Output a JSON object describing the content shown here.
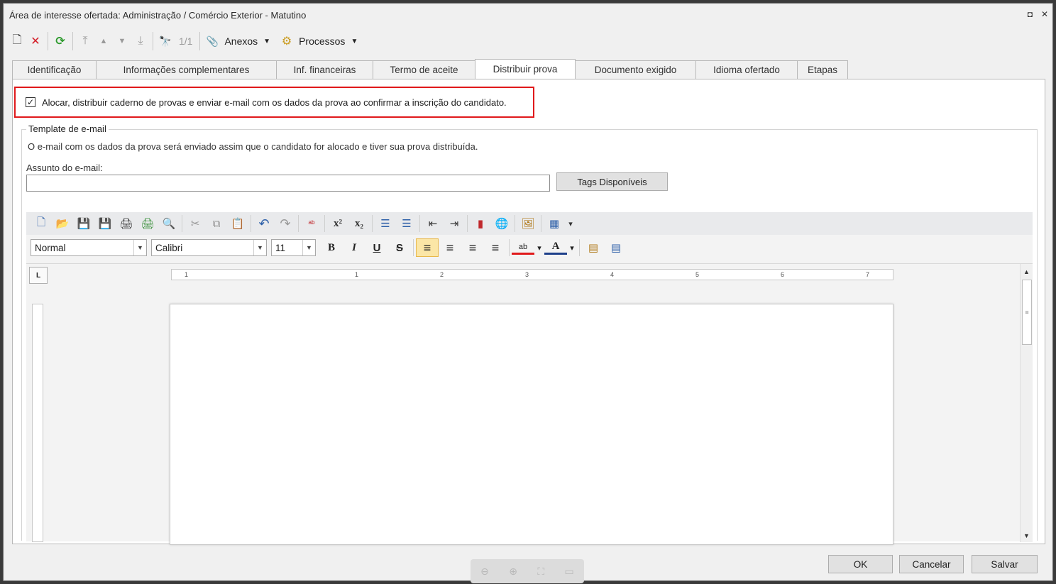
{
  "window": {
    "title": "Área de interesse ofertada: Administração / Comércio Exterior - Matutino",
    "restore_glyph": "◘",
    "close_glyph": "✕"
  },
  "toolbar": {
    "new_glyph": "🗋",
    "delete_glyph": "✕",
    "refresh_glyph": "⟳",
    "first_glyph": "⤒",
    "prev_glyph": "▲",
    "next_glyph": "▼",
    "last_glyph": "⤓",
    "find_glyph": "🔭",
    "record_counter": "1/1",
    "attach_glyph": "📎",
    "attachments_label": "Anexos",
    "process_glyph": "⚙",
    "processes_label": "Processos",
    "drop_glyph": "▼",
    "icons": [
      "new-icon",
      "delete-icon",
      "refresh-icon",
      "first-record-icon",
      "previous-record-icon",
      "next-record-icon",
      "last-record-icon",
      "binoculars-icon",
      "paperclip-icon",
      "gears-icon"
    ]
  },
  "tabs": [
    {
      "label": "Identificação",
      "active": false
    },
    {
      "label": "Informações complementares",
      "active": false
    },
    {
      "label": "Inf. financeiras",
      "active": false
    },
    {
      "label": "Termo de aceite",
      "active": false
    },
    {
      "label": "Distribuir prova",
      "active": true
    },
    {
      "label": "Documento exigido",
      "active": false
    },
    {
      "label": "Idioma ofertado",
      "active": false
    },
    {
      "label": "Etapas",
      "active": false
    }
  ],
  "panel": {
    "checkbox_checked": true,
    "checkbox_glyph": "✓",
    "checkbox_label": "Alocar, distribuir caderno de provas e enviar e-mail com os dados da prova ao confirmar a inscrição do candidato.",
    "highlight_color": "#e0191b",
    "group_title": "Template de e-mail",
    "info_text": "O e-mail com os dados da prova será enviado assim que o candidato for alocado e tiver sua prova distribuída.",
    "subject_label": "Assunto do e-mail:",
    "subject_value": "",
    "tags_button": "Tags Disponíveis"
  },
  "editor": {
    "toolbar1": {
      "icons": [
        "new-doc-icon",
        "open-folder-icon",
        "save-icon",
        "save-as-icon",
        "print-icon",
        "quick-print-icon",
        "print-preview-icon",
        "cut-icon",
        "copy-icon",
        "paste-icon",
        "undo-icon",
        "redo-icon",
        "spellcheck-icon",
        "superscript-icon",
        "subscript-icon",
        "numbered-list-icon",
        "bullet-list-icon",
        "decrease-indent-icon",
        "increase-indent-icon",
        "bookmark-icon",
        "hyperlink-icon",
        "picture-icon",
        "table-icon",
        "table-dropdown-icon"
      ],
      "glyphs": {
        "new": "🗋",
        "open": "📂",
        "save": "💾",
        "save_as": "💾",
        "print": "🖨",
        "quick_print": "🖨",
        "preview": "🔍",
        "cut": "✂",
        "copy": "⧉",
        "paste": "📋",
        "undo": "↶",
        "redo": "↷",
        "spell": "ᵃᵇ",
        "superscript": "x²",
        "subscript": "x₂",
        "numbered": "☰",
        "bullets": "☰",
        "outdent": "⇤",
        "indent": "⇥",
        "bookmark": "▮",
        "link": "🌐",
        "picture": "🖼",
        "table": "▦",
        "drop": "▾"
      }
    },
    "toolbar2": {
      "style_value": "Normal",
      "font_value": "Calibri",
      "size_value": "11",
      "combo_arrow": "▼",
      "bold_label": "B",
      "italic_label": "I",
      "underline_label": "U",
      "strike_label": "S",
      "align_left_glyph": "≡",
      "align_center_glyph": "≡",
      "align_right_glyph": "≡",
      "justify_glyph": "≡",
      "highlight_glyph": "ab",
      "font_color_glyph": "A",
      "drop_glyph": "▾",
      "paragraph_glyph": "▤",
      "page_glyph": "▤",
      "active_alignment": "left",
      "active_color": "#fbe6a6"
    },
    "ruler": {
      "corner_glyph": "L",
      "tick_labels": [
        "1",
        "1",
        "2",
        "3",
        "4",
        "5",
        "6",
        "7"
      ]
    },
    "scroll": {
      "up_glyph": "▲",
      "down_glyph": "▼",
      "grip_glyph": "≡"
    }
  },
  "zoom": {
    "zoom_out_glyph": "⊖",
    "zoom_in_glyph": "⊕",
    "fit_glyph": "⛶",
    "present_glyph": "▭"
  },
  "buttons": {
    "ok": "OK",
    "cancel": "Cancelar",
    "save": "Salvar"
  }
}
